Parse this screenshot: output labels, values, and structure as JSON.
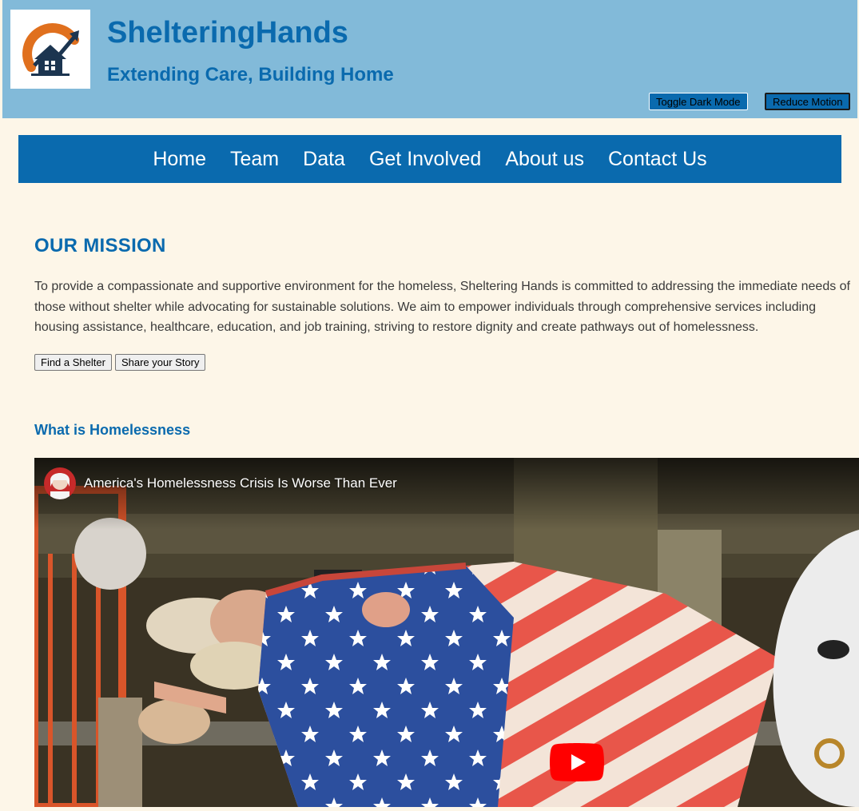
{
  "header": {
    "site_title": "ShelteringHands",
    "tagline": "Extending Care, Building Home",
    "toggle_dark_label": "Toggle Dark Mode",
    "reduce_motion_label": "Reduce Motion",
    "logo_icon": "house-growth-arrow-icon"
  },
  "nav": {
    "items": [
      {
        "label": "Home"
      },
      {
        "label": "Team"
      },
      {
        "label": "Data"
      },
      {
        "label": "Get Involved"
      },
      {
        "label": "About us"
      },
      {
        "label": "Contact Us"
      }
    ]
  },
  "mission": {
    "title": "OUR MISSION",
    "text": "To provide a compassionate and supportive environment for the homeless, Sheltering Hands is committed to addressing the immediate needs of those without shelter while advocating for sustainable solutions. We aim to empower individuals through comprehensive services including housing assistance, healthcare, education, and job training, striving to restore dignity and create pathways out of homelessness.",
    "buttons": {
      "find_shelter": "Find a Shelter",
      "share_story": "Share your Story"
    }
  },
  "homelessness": {
    "title": "What is Homelessness",
    "video_title": "America's Homelessness Crisis Is Worse Than Ever",
    "play_icon": "youtube-play-icon"
  },
  "colors": {
    "primary": "#0a6aae",
    "header_bg": "#82bad9",
    "page_bg": "#fdf6e8",
    "logo_orange": "#e0701e",
    "logo_navy": "#1c3550"
  }
}
